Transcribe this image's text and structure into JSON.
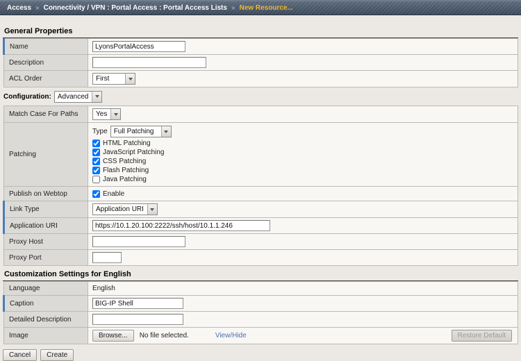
{
  "breadcrumb": {
    "separator": "»",
    "items": [
      {
        "label": "Access"
      },
      {
        "label": "Connectivity / VPN : Portal Access : Portal Access Lists"
      },
      {
        "label": "New Resource..."
      }
    ]
  },
  "colors": {
    "accent_required_blue": "#4a7db5",
    "breadcrumb_current_gold": "#f0b92b",
    "link_blue": "#4a6fae"
  },
  "sections": {
    "general": {
      "title": "General Properties",
      "rows": {
        "name": {
          "label": "Name",
          "value": "LyonsPortalAccess"
        },
        "description": {
          "label": "Description",
          "value": ""
        },
        "acl_order": {
          "label": "ACL Order",
          "value": "First"
        }
      }
    },
    "configuration": {
      "label": "Configuration:",
      "mode": "Advanced",
      "rows": {
        "match_case": {
          "label": "Match Case For Paths",
          "value": "Yes"
        },
        "patching": {
          "label": "Patching",
          "type_label": "Type",
          "type_value": "Full Patching",
          "checkboxes": [
            {
              "label": "HTML Patching",
              "checked": true
            },
            {
              "label": "JavaScript Patching",
              "checked": true
            },
            {
              "label": "CSS Patching",
              "checked": true
            },
            {
              "label": "Flash Patching",
              "checked": true
            },
            {
              "label": "Java Patching",
              "checked": false
            }
          ]
        },
        "publish": {
          "label": "Publish on Webtop",
          "checkbox_label": "Enable",
          "checked": true
        },
        "link_type": {
          "label": "Link Type",
          "value": "Application URI"
        },
        "application_uri": {
          "label": "Application URI",
          "value": "https://10.1.20.100:2222/ssh/host/10.1.1.246"
        },
        "proxy_host": {
          "label": "Proxy Host",
          "value": ""
        },
        "proxy_port": {
          "label": "Proxy Port",
          "value": ""
        }
      }
    },
    "customization": {
      "title": "Customization Settings for English",
      "rows": {
        "language": {
          "label": "Language",
          "value": "English"
        },
        "caption": {
          "label": "Caption",
          "value": "BIG-IP Shell"
        },
        "detailed_description": {
          "label": "Detailed Description",
          "value": ""
        },
        "image": {
          "label": "Image",
          "browse_label": "Browse...",
          "file_status": "No file selected.",
          "view_hide_label": "View/Hide",
          "restore_default_label": "Restore Default"
        }
      }
    }
  },
  "footer": {
    "cancel_label": "Cancel",
    "create_label": "Create"
  }
}
